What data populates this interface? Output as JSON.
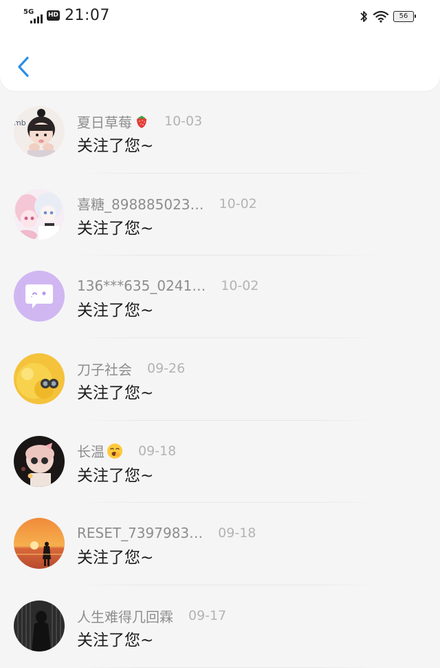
{
  "status_bar": {
    "network": "5G",
    "hd": "HD",
    "time": "21:07",
    "battery": "56"
  },
  "notifications": [
    {
      "name": "夏日草莓",
      "date": "10-03",
      "message": "关注了您~",
      "badge": "strawberry-emoji"
    },
    {
      "name": "喜糖_898885023…",
      "date": "10-02",
      "message": "关注了您~"
    },
    {
      "name": "136***635_0241…",
      "date": "10-02",
      "message": "关注了您~"
    },
    {
      "name": "刀子社会",
      "date": "09-26",
      "message": "关注了您~"
    },
    {
      "name": "长温",
      "date": "09-18",
      "message": "关注了您~",
      "badge": "yawning-face-emoji"
    },
    {
      "name": "RESET_7397983…",
      "date": "09-18",
      "message": "关注了您~"
    },
    {
      "name": "人生难得几回霖",
      "date": "09-17",
      "message": "关注了您~"
    }
  ],
  "colors": {
    "accent": "#2a8ee6",
    "background": "#f5f5f6",
    "name_text": "#8d8d8d",
    "date_text": "#b3b3b3"
  }
}
